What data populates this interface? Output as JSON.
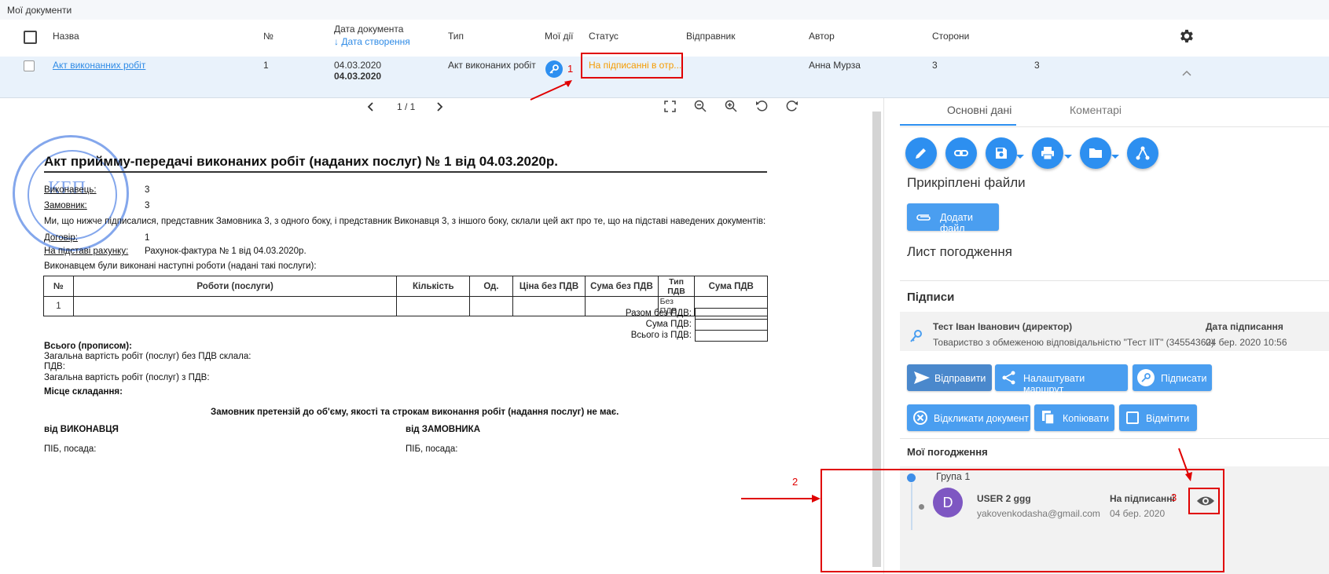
{
  "topbar": {
    "title": "Мої документи"
  },
  "table_header": {
    "name": "Назва",
    "number": "№",
    "doc_date": "Дата документа",
    "created_sort": "↓ Дата створення",
    "type": "Тип",
    "my_actions": "Мої дії",
    "status": "Статус",
    "sender": "Відправник",
    "author": "Автор",
    "parties": "Сторони"
  },
  "row": {
    "name": "Акт виконанних робіт",
    "number": "1",
    "doc_date": "04.03.2020",
    "created_date": "04.03.2020",
    "type": "Акт виконаних робіт",
    "status": "На підписанні в отр...",
    "author": "Анна Мурза",
    "parties_a": "3",
    "parties_b": "3"
  },
  "annotations": {
    "n1": "1",
    "n2": "2",
    "n3": "3"
  },
  "viewer": {
    "page": "1 / 1"
  },
  "stamp": {
    "center_text": "КЕП"
  },
  "document": {
    "title": "Акт приймму-передачі виконаних робіт (наданих послуг) № 1 від 04.03.2020р.",
    "executor_label": "Виконавець:",
    "executor_value": "3",
    "customer_label": "Замовник:",
    "customer_value": "3",
    "preamble": "Ми, що нижче підписалися, представник Замовника 3, з одного боку, і представник Виконавця 3, з іншого боку, склали цей акт про те, що на підставі наведених документів:",
    "contract_label": "Договір:",
    "contract_value": "1",
    "invoice_label": "На підставі рахунку:",
    "invoice_value": "Рахунок-фактура № 1 від 04.03.2020р.",
    "works_intro": "Виконавцем були виконані наступні роботи (надані такі послуги):",
    "table_headers": [
      "№",
      "Роботи (послуги)",
      "Кількість",
      "Од.",
      "Ціна без ПДВ",
      "Сума без ПДВ",
      "Тип ПДВ",
      "Сума ПДВ"
    ],
    "table_row": [
      "1",
      "",
      "",
      "",
      "",
      "",
      "Без ПДВ",
      ""
    ],
    "total_no_vat": "Разом без ПДВ:",
    "vat_sum": "Сума ПДВ:",
    "total_with_vat": "Всього із ПДВ:",
    "in_words": "Всього (прописом):",
    "total_cost_no_vat": "Загальна вартість робіт (послуг) без ПДВ склала:",
    "vat": "ПДВ:",
    "total_cost_vat": "Загальна вартість робіт (послуг) з ПДВ:",
    "place": "Місце складання:",
    "no_claims": "Замовник претензій до об'єму, якості та строкам виконання робіт (надання послуг) не має.",
    "from_executor": "від ВИКОНАВЦЯ",
    "from_customer": "від ЗАМОВНИКА",
    "name_pos_1": "ПІБ, посада:",
    "name_pos_2": "ПІБ, посада:"
  },
  "panel": {
    "tab_main": "Основні дані",
    "tab_comments": "Коментарі",
    "attached_files": "Прикріплені файли",
    "add_file": "Додати файл",
    "approval_sheet": "Лист погодження",
    "signatures": "Підписи",
    "signer_name": "Тест Іван Іванович (директор)",
    "signer_org": "Товариство з обмеженою відповідальністю \"Тест IIT\" (34554362)",
    "sign_date_label": "Дата підписання",
    "sign_date": "04 бер. 2020 10:56",
    "send": "Відправити",
    "route": "Налаштувати маршрут",
    "sign": "Підписати",
    "revoke": "Відкликати документ",
    "copy": "Копіювати",
    "mark": "Відмітити",
    "my_approvals": "Мої погодження",
    "group": "Група 1",
    "user_initial": "D",
    "user_name": "USER 2 ggg",
    "user_email": "yakovenkodasha@gmail.com",
    "user_status": "На підписанні",
    "user_date": "04 бер. 2020"
  },
  "colors": {
    "accent": "#2d8ff0",
    "status": "#f59b00",
    "annotation": "#e00000",
    "avatar": "#7e57c2"
  }
}
